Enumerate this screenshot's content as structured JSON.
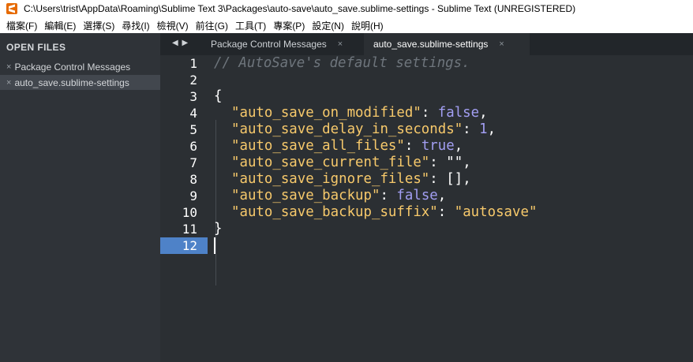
{
  "window": {
    "title": "C:\\Users\\trist\\AppData\\Roaming\\Sublime Text 3\\Packages\\auto-save\\auto_save.sublime-settings - Sublime Text (UNREGISTERED)",
    "icon": "sublime-text-icon"
  },
  "menu": [
    "檔案(F)",
    "編輯(E)",
    "選擇(S)",
    "尋找(I)",
    "檢視(V)",
    "前往(G)",
    "工具(T)",
    "專案(P)",
    "設定(N)",
    "說明(H)"
  ],
  "sidebar": {
    "header": "OPEN FILES",
    "files": [
      {
        "close": "×",
        "label": "Package Control Messages"
      },
      {
        "close": "×",
        "label": "auto_save.sublime-settings"
      }
    ]
  },
  "tabs": [
    {
      "label": "Package Control Messages",
      "close": "×"
    },
    {
      "label": "auto_save.sublime-settings",
      "close": "×"
    }
  ],
  "nav": {
    "arrows": "◀ ▶"
  },
  "editor": {
    "current_line": 12,
    "lines": [
      {
        "num": "1",
        "comment": "// AutoSave's default settings."
      },
      {
        "num": "2"
      },
      {
        "num": "3",
        "punct": "{"
      },
      {
        "num": "4",
        "key": "\"auto_save_on_modified\"",
        "sep": ": ",
        "val": "false",
        "val_type": "kw",
        "end": ","
      },
      {
        "num": "5",
        "key": "\"auto_save_delay_in_seconds\"",
        "sep": ": ",
        "val": "1",
        "val_type": "num",
        "end": ","
      },
      {
        "num": "6",
        "key": "\"auto_save_all_files\"",
        "sep": ": ",
        "val": "true",
        "val_type": "kw",
        "end": ","
      },
      {
        "num": "7",
        "key": "\"auto_save_current_file\"",
        "sep": ": ",
        "val": "\"\"",
        "val_type": "plain",
        "end": ","
      },
      {
        "num": "8",
        "key": "\"auto_save_ignore_files\"",
        "sep": ": ",
        "val": "[]",
        "val_type": "plain",
        "end": ","
      },
      {
        "num": "9",
        "key": "\"auto_save_backup\"",
        "sep": ": ",
        "val": "false",
        "val_type": "kw",
        "end": ","
      },
      {
        "num": "10",
        "key": "\"auto_save_backup_suffix\"",
        "sep": ": ",
        "val": "\"autosave\"",
        "val_type": "plain",
        "end": ""
      },
      {
        "num": "11",
        "punct": "}"
      },
      {
        "num": "12"
      }
    ]
  },
  "colors": {
    "string": "#f7c96b",
    "keyword": "#a29ef2",
    "comment": "#6e757c",
    "selection_gutter": "#4e82c8",
    "background": "#2b2f33"
  }
}
